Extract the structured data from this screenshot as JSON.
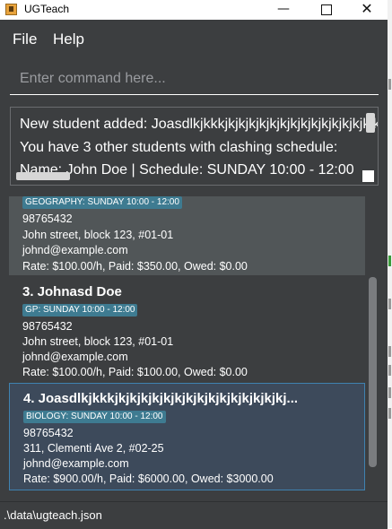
{
  "window": {
    "title": "UGTeach",
    "minimize_icon": "minimize-icon",
    "maximize_icon": "maximize-icon",
    "close_icon": "close-icon"
  },
  "menu": {
    "file": "File",
    "help": "Help"
  },
  "command": {
    "placeholder": "Enter command here...",
    "value": ""
  },
  "result": {
    "lines": [
      "New student added: Joasdlkjkkkjkjkjkjkjkjkjkjkjkjkjkjkjkjkjkjl",
      "You have 3 other students with clashing schedule:",
      "Name: John Doe | Schedule: SUNDAY 10:00 - 12:00"
    ]
  },
  "students": [
    {
      "name": "",
      "tag": "GEOGRAPHY: SUNDAY 10:00 - 12:00",
      "phone": "98765432",
      "address": "John street, block 123, #01-01",
      "email": "johnd@example.com",
      "payment": "Rate: $100.00/h, Paid: $350.00, Owed: $0.00"
    },
    {
      "name": "3. Johnasd Doe",
      "tag": "GP: SUNDAY 10:00 - 12:00",
      "phone": "98765432",
      "address": "John street, block 123, #01-01",
      "email": "johnd@example.com",
      "payment": "Rate: $100.00/h, Paid: $100.00, Owed: $0.00"
    },
    {
      "name": "4. Joasdlkjkkkjkjkjkjkjkjkjkjkjkjkjkjkjkjkjkj...",
      "tag": "BIOLOGY: SUNDAY 10:00 - 12:00",
      "phone": "98765432",
      "address": "311, Clementi Ave 2, #02-25",
      "email": "johnd@example.com",
      "payment": "Rate: $900.00/h, Paid: $6000.00, Owed: $3000.00"
    }
  ],
  "status": {
    "path": ".\\data\\ugteach.json"
  },
  "colors": {
    "background": "#3c3e40",
    "card_alt": "#515658",
    "selected": "#3d4a5b",
    "selected_border": "#3f82b0",
    "tag": "#3e7b91"
  }
}
